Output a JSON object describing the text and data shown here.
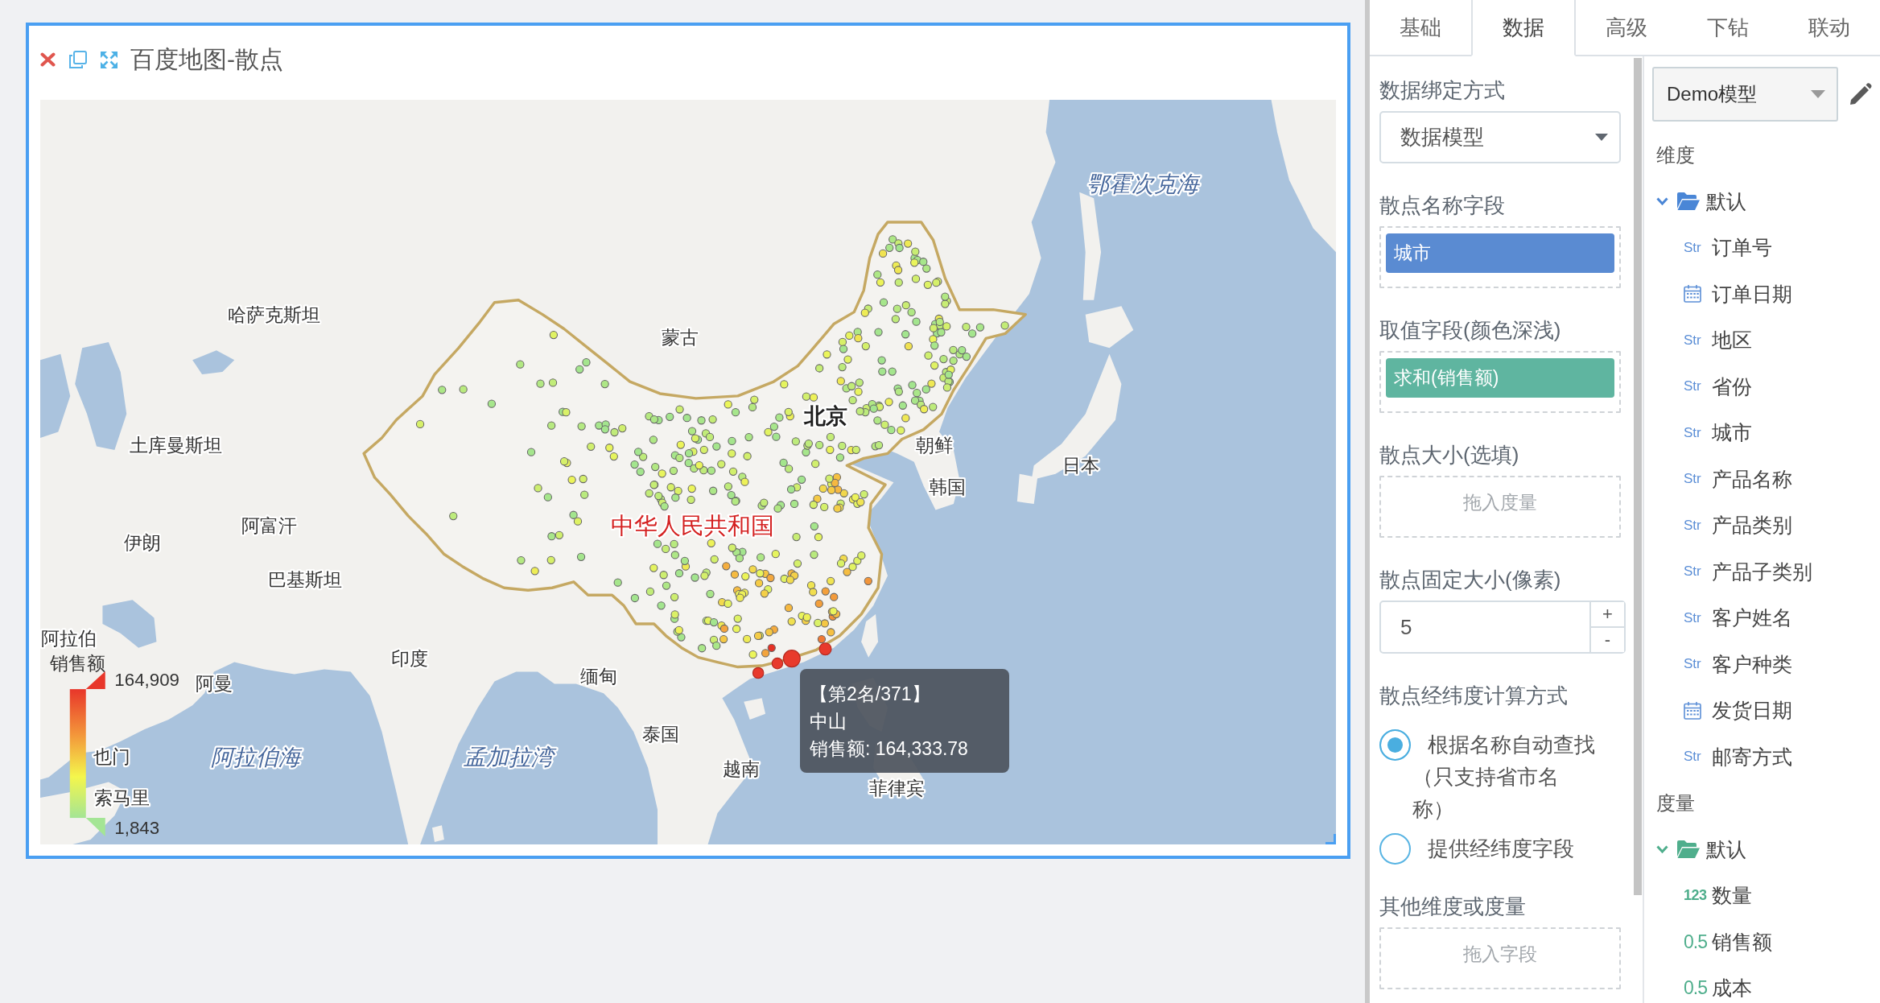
{
  "chart_card": {
    "title": "百度地图-散点",
    "map_labels": [
      {
        "kind": "sea",
        "text": "鄂霍次克海"
      },
      {
        "kind": "country",
        "text": "哈萨克斯坦"
      },
      {
        "kind": "country",
        "text": "蒙古"
      },
      {
        "kind": "capital",
        "text": "北京"
      },
      {
        "kind": "country",
        "text": "土库曼斯坦"
      },
      {
        "kind": "country",
        "text": "朝鲜"
      },
      {
        "kind": "country",
        "text": "韩国"
      },
      {
        "kind": "country",
        "text": "日本"
      },
      {
        "kind": "country",
        "text": "伊朗"
      },
      {
        "kind": "country",
        "text": "阿富汗"
      },
      {
        "kind": "home",
        "text": "中华人民共和国"
      },
      {
        "kind": "country",
        "text": "巴基斯坦"
      },
      {
        "kind": "country",
        "text": "阿拉伯"
      },
      {
        "kind": "country",
        "text": "印度"
      },
      {
        "kind": "country",
        "text": "阿曼"
      },
      {
        "kind": "country",
        "text": "缅甸"
      },
      {
        "kind": "country",
        "text": "泰国"
      },
      {
        "kind": "country",
        "text": "也门"
      },
      {
        "kind": "sea",
        "text": "阿拉伯海"
      },
      {
        "kind": "sea",
        "text": "孟加拉湾"
      },
      {
        "kind": "country",
        "text": "越南"
      },
      {
        "kind": "country",
        "text": "索马里"
      },
      {
        "kind": "country",
        "text": "菲律宾"
      }
    ],
    "legend": {
      "title": "销售额",
      "max": "164,909",
      "min": "1,843"
    },
    "tooltip": {
      "rank": "【第2名/371】",
      "name": "中山",
      "value": "销售额: 164,333.78"
    }
  },
  "tabs": [
    {
      "label": "基础",
      "selected": false
    },
    {
      "label": "数据",
      "selected": true
    },
    {
      "label": "高级",
      "selected": false
    },
    {
      "label": "下钻",
      "selected": false
    },
    {
      "label": "联动",
      "selected": false
    }
  ],
  "data_form": {
    "sections": [
      {
        "kind": "select",
        "label": "数据绑定方式",
        "value": "数据模型"
      },
      {
        "kind": "drop",
        "label": "散点名称字段",
        "chips": [
          {
            "kind": "dimension",
            "text": "城市"
          }
        ]
      },
      {
        "kind": "drop",
        "label": "取值字段(颜色深浅)",
        "chips": [
          {
            "kind": "measure",
            "text": "求和(销售额)"
          }
        ]
      },
      {
        "kind": "drop",
        "label": "散点大小(选填)",
        "placeholder": "拖入度量"
      },
      {
        "kind": "number",
        "label": "散点固定大小(像素)",
        "value": "5",
        "increment": "+",
        "decrement": "-"
      },
      {
        "kind": "radio",
        "label": "散点经纬度计算方式",
        "options": [
          {
            "label": "根据名称自动查找（只支持省市名称）",
            "selected": true
          },
          {
            "label": "提供经纬度字段",
            "selected": false
          }
        ]
      },
      {
        "kind": "drop",
        "label": "其他维度或度量",
        "placeholder": "拖入字段"
      }
    ]
  },
  "field_list": {
    "model": "Demo模型",
    "groups": [
      {
        "kind": "dimension",
        "heading": "维度",
        "folders": [
          {
            "name": "默认",
            "expanded": true,
            "fields": [
              {
                "kind": "string",
                "badge": "Str",
                "name": "订单号"
              },
              {
                "kind": "date",
                "name": "订单日期"
              },
              {
                "kind": "string",
                "badge": "Str",
                "name": "地区"
              },
              {
                "kind": "string",
                "badge": "Str",
                "name": "省份"
              },
              {
                "kind": "string",
                "badge": "Str",
                "name": "城市"
              },
              {
                "kind": "string",
                "badge": "Str",
                "name": "产品名称"
              },
              {
                "kind": "string",
                "badge": "Str",
                "name": "产品类别"
              },
              {
                "kind": "string",
                "badge": "Str",
                "name": "产品子类别"
              },
              {
                "kind": "string",
                "badge": "Str",
                "name": "客户姓名"
              },
              {
                "kind": "string",
                "badge": "Str",
                "name": "客户种类"
              },
              {
                "kind": "date",
                "name": "发货日期"
              },
              {
                "kind": "string",
                "badge": "Str",
                "name": "邮寄方式"
              }
            ]
          }
        ]
      },
      {
        "kind": "measure",
        "heading": "度量",
        "folders": [
          {
            "name": "默认",
            "expanded": true,
            "fields": [
              {
                "kind": "integer",
                "badge": "123",
                "name": "数量"
              },
              {
                "kind": "decimal",
                "badge": "0.5",
                "name": "销售额"
              },
              {
                "kind": "decimal",
                "badge": "0.5",
                "name": "成本"
              }
            ]
          }
        ]
      }
    ]
  }
}
